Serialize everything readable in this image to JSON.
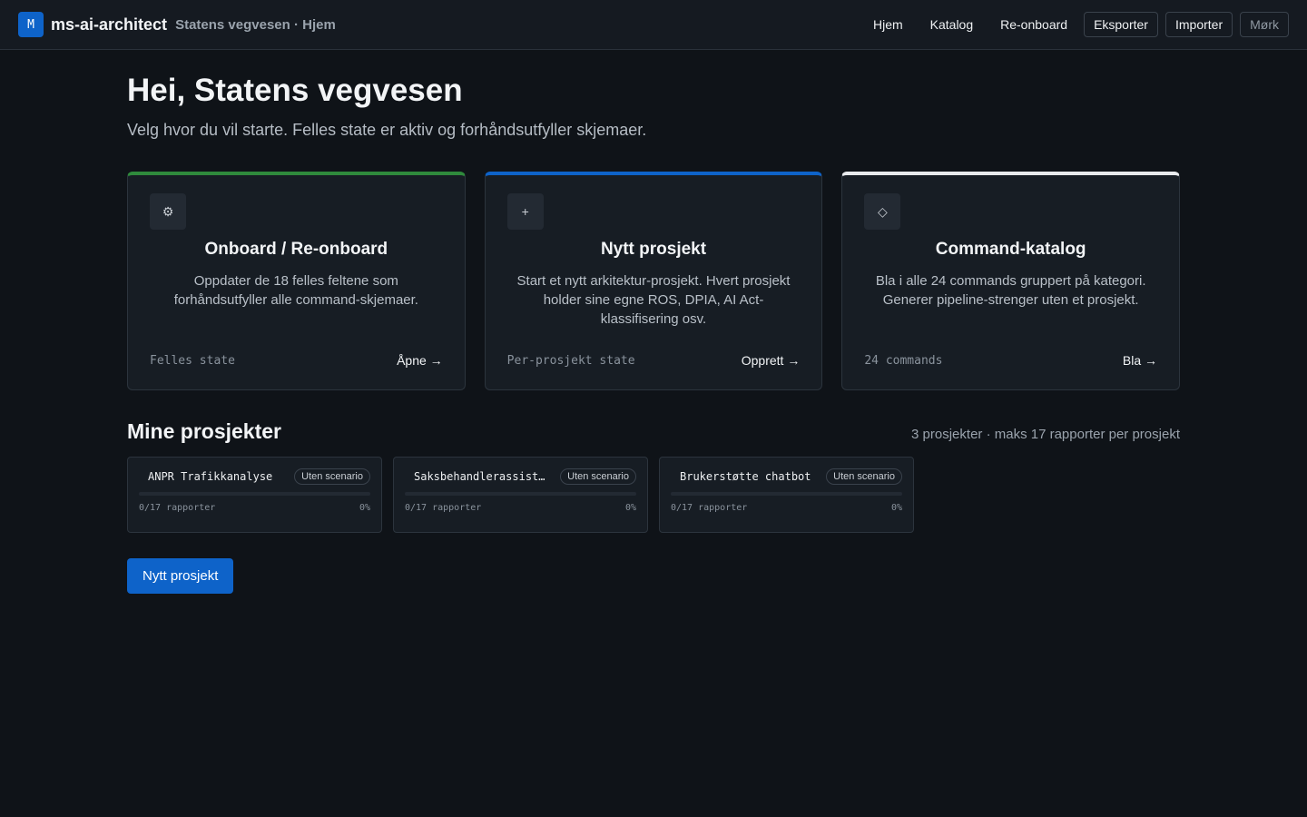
{
  "header": {
    "logo_letter": "M",
    "app_name": "ms-ai-architect",
    "context": "Statens vegvesen · Hjem",
    "nav": {
      "home": "Hjem",
      "catalog": "Katalog",
      "reonboard": "Re-onboard",
      "export": "Eksporter",
      "import": "Importer",
      "theme": "Mørk"
    }
  },
  "hero": {
    "title": "Hei, Statens vegvesen",
    "subtitle": "Velg hvor du vil starte. Felles state er aktiv og forhåndsutfyller skjemaer."
  },
  "cards": [
    {
      "icon": "gear-icon",
      "icon_glyph": "⚙",
      "title": "Onboard / Re-onboard",
      "description": "Oppdater de 18 felles feltene som forhåndsutfyller alle command-skjemaer.",
      "meta": "Felles state",
      "action": "Åpne →",
      "accent": "#2f8a3c"
    },
    {
      "icon": "plus-icon",
      "icon_glyph": "+",
      "title": "Nytt prosjekt",
      "description": "Start et nytt arkitektur-prosjekt. Hvert prosjekt holder sine egne ROS, DPIA, AI Act-klassifisering osv.",
      "meta": "Per-prosjekt state",
      "action": "Opprett →",
      "accent": "#0e63c9"
    },
    {
      "icon": "diamond-icon",
      "icon_glyph": "◇",
      "title": "Command-katalog",
      "description": "Bla i alle 24 commands gruppert på kategori. Generer pipeline-strenger uten et prosjekt.",
      "meta": "24 commands",
      "action": "Bla →",
      "accent": "#e8eaed"
    }
  ],
  "projects": {
    "title": "Mine prosjekter",
    "meta": "3 prosjekter · maks 17 rapporter per prosjekt",
    "items": [
      {
        "name": "ANPR Trafikkanalyse",
        "badge": "Uten scenario",
        "reports": "0/17 rapporter",
        "percent": "0%",
        "progress": 0
      },
      {
        "name": "Saksbehandlerassiste…",
        "badge": "Uten scenario",
        "reports": "0/17 rapporter",
        "percent": "0%",
        "progress": 0
      },
      {
        "name": "Brukerstøtte chatbot",
        "badge": "Uten scenario",
        "reports": "0/17 rapporter",
        "percent": "0%",
        "progress": 0
      }
    ],
    "new_button": "Nytt prosjekt"
  },
  "colors": {
    "background": "#0f1318",
    "accent": "#0e63c9",
    "success": "#2f8a3c"
  }
}
